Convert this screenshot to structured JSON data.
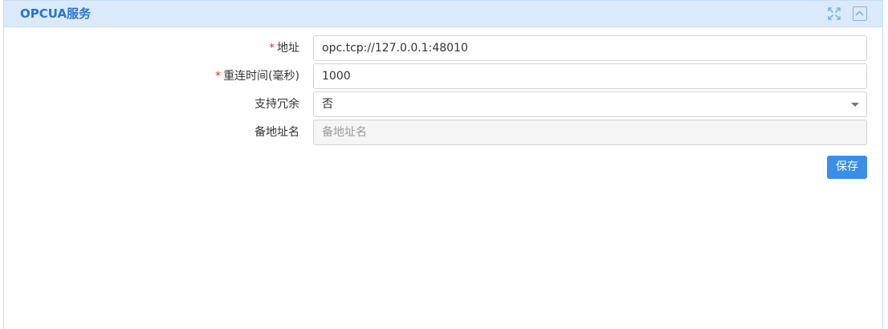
{
  "panel": {
    "title": "OPCUA服务",
    "expand_icon": "expand-icon",
    "collapse_icon": "collapse-up-icon"
  },
  "form": {
    "address": {
      "required_mark": "*",
      "label": "地址",
      "value": "opc.tcp://127.0.0.1:48010"
    },
    "reconnect": {
      "required_mark": "*",
      "label": "重连时间(毫秒)",
      "value": "1000"
    },
    "redundancy": {
      "label": "支持冗余",
      "selected": "否"
    },
    "backup_address": {
      "label": "备地址名",
      "placeholder": "备地址名"
    }
  },
  "actions": {
    "save_label": "保存"
  },
  "colors": {
    "header_bg": "#daeafa",
    "title": "#2a74d0",
    "primary_button": "#3a8ee6",
    "required": "#e8322d"
  }
}
